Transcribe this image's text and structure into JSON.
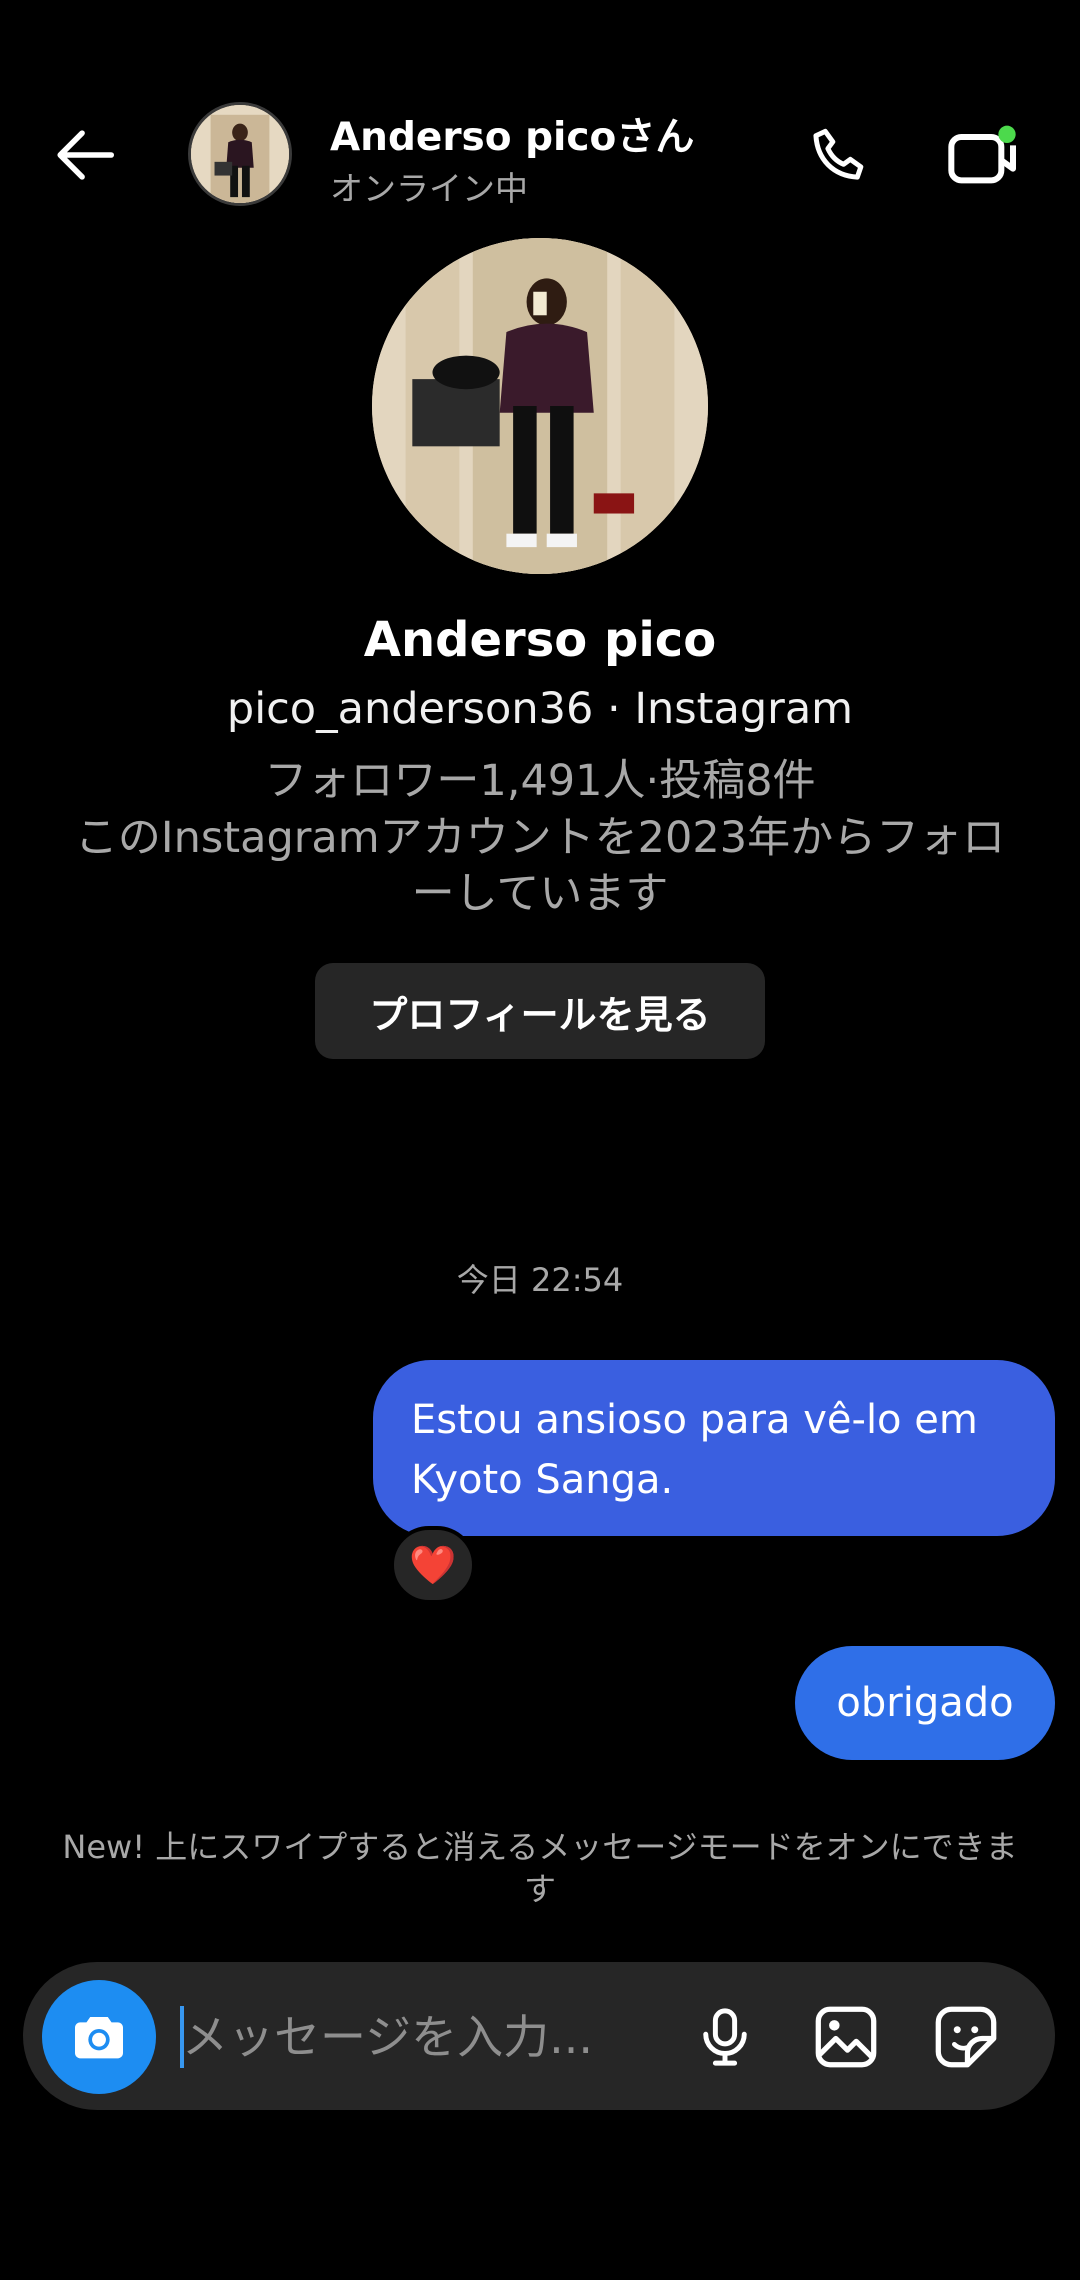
{
  "header": {
    "name": "Anderso picoさん",
    "status": "オンライン中",
    "icons": [
      "back-arrow-icon",
      "phone-icon",
      "video-call-icon"
    ],
    "online_dot_color": "#4cd94c"
  },
  "profile": {
    "name": "Anderso pico",
    "handle_line": "pico_anderson36 · Instagram",
    "stats": "フォロワー1,491人·投稿8件",
    "follow_since": "このInstagramアカウントを2023年からフォローしています",
    "view_profile_label": "プロフィールを見る"
  },
  "messages": {
    "timestamp": "今日 22:54",
    "items": [
      {
        "text": "Estou ansioso para vê-lo em Kyoto Sanga.",
        "reaction": "❤️",
        "color": "#3a5fe0"
      },
      {
        "text": "obrigado",
        "color": "#2f6fe8"
      }
    ]
  },
  "hint": "New! 上にスワイプすると消えるメッセージモードをオンにできます",
  "composer": {
    "placeholder": "メッセージを入力...",
    "icons": [
      "camera-icon",
      "microphone-icon",
      "gallery-icon",
      "sticker-icon"
    ],
    "camera_color": "#1d8df2"
  }
}
